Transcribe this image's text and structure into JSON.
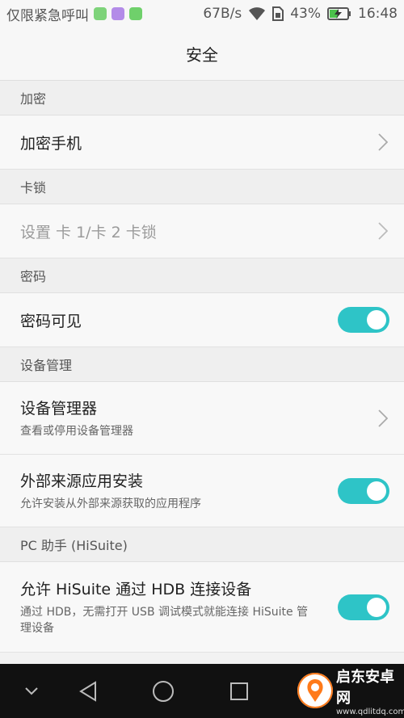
{
  "status_bar": {
    "carrier": "仅限紧急呼叫",
    "network_speed": "67B/s",
    "battery_percent": "43%",
    "time": "16:48",
    "app_icon_colors": [
      "#7ed37a",
      "#b38be8",
      "#6fd06b"
    ]
  },
  "header": {
    "title": "安全"
  },
  "sections": [
    {
      "header": "加密",
      "items": [
        {
          "title": "加密手机",
          "control": "chevron"
        }
      ]
    },
    {
      "header": "卡锁",
      "items": [
        {
          "title": "设置 卡 1/卡 2 卡锁",
          "control": "chevron",
          "disabled": true
        }
      ]
    },
    {
      "header": "密码",
      "items": [
        {
          "title": "密码可见",
          "control": "toggle",
          "toggle_on": true
        }
      ]
    },
    {
      "header": "设备管理",
      "items": [
        {
          "title": "设备管理器",
          "subtitle": "查看或停用设备管理器",
          "control": "chevron"
        },
        {
          "title": "外部来源应用安装",
          "subtitle": "允许安装从外部来源获取的应用程序",
          "control": "toggle",
          "toggle_on": true
        }
      ]
    },
    {
      "header": "PC 助手 (HiSuite)",
      "items": [
        {
          "title": "允许 HiSuite 通过 HDB 连接设备",
          "subtitle": "通过 HDB，无需打开 USB 调试模式就能连接 HiSuite 管理设备",
          "control": "toggle",
          "toggle_on": true
        }
      ]
    }
  ],
  "colors": {
    "toggle_on": "#2ec4c7",
    "nav_bar": "#111111"
  },
  "navigation": {
    "buttons": [
      "chevron-down-icon",
      "back-icon",
      "home-icon",
      "recents-icon"
    ]
  },
  "watermark": {
    "title": "启东安卓网",
    "url": "www.qdlitdq.com"
  }
}
